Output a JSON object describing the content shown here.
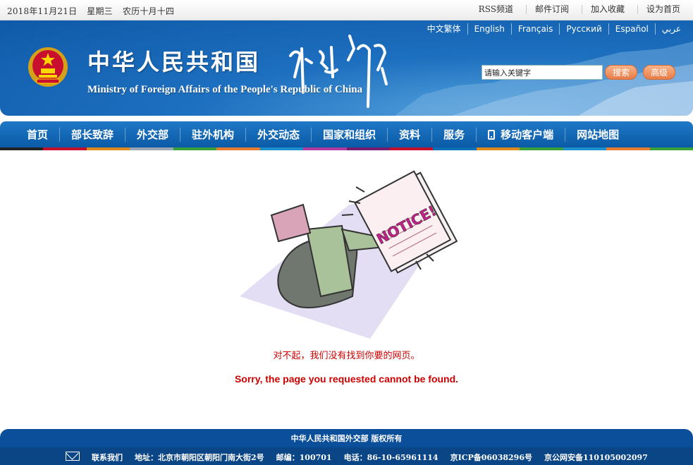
{
  "topbar": {
    "date": "2018年11月21日",
    "weekday": "星期三",
    "lunar": "农历十月十四",
    "links": [
      "RSS频道",
      "邮件订阅",
      "加入收藏",
      "设为首页"
    ]
  },
  "header": {
    "title_cn": "中华人民共和国",
    "title_en": "Ministry of  Foreign Affairs of the People's Republic of China",
    "languages": [
      "中文繁体",
      "English",
      "Français",
      "Русский",
      "Español",
      "عربي"
    ],
    "search_placeholder": "请输入关键字",
    "search_button": "搜索",
    "advanced_button": "高级"
  },
  "nav": {
    "items": [
      "首页",
      "部长致辞",
      "外交部",
      "驻外机构",
      "外交动态",
      "国家和组织",
      "资料",
      "服务",
      "移动客户端",
      "网站地图"
    ],
    "strip_colors": [
      "#222222",
      "#c8102e",
      "#e08a1e",
      "#9aa7b3",
      "#3aa03a",
      "#e87c2e",
      "#1c8fcf",
      "#b03aa0",
      "#7a1c6e",
      "#c8102e",
      "#0d6eb8",
      "#e08a1e",
      "#3aa03a",
      "#1c8fcf",
      "#e87c2e",
      "#3aa03a"
    ]
  },
  "content": {
    "notice_text": "NOTICE!",
    "message_cn": "对不起，我们没有找到你要的网页。",
    "message_en": "Sorry, the page you requested cannot be found."
  },
  "footer": {
    "copyright": "中华人民共和国外交部  版权所有",
    "contact": "联系我们",
    "address": "地址：北京市朝阳区朝阳门南大街2号",
    "postcode": "邮编：100701",
    "phone": "电话：86-10-65961114",
    "icp": "京ICP备06038296号",
    "police": "京公网安备110105002097"
  }
}
